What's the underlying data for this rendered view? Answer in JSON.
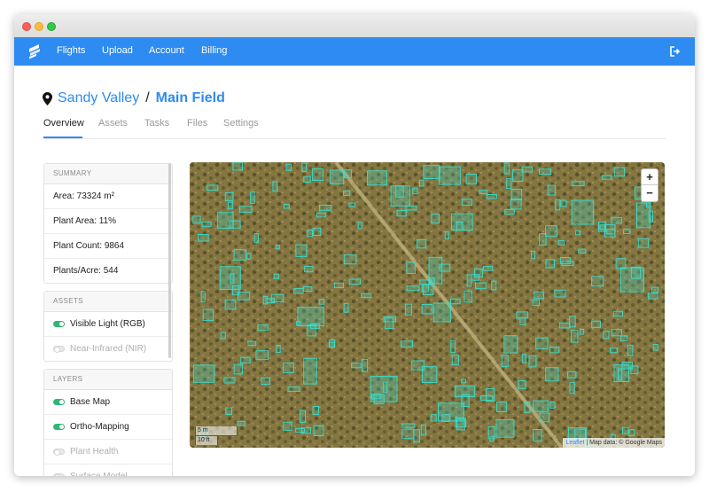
{
  "nav": {
    "items": [
      "Flights",
      "Upload",
      "Account",
      "Billing"
    ]
  },
  "breadcrumb": {
    "parent": "Sandy Valley",
    "separator": "/",
    "current": "Main Field"
  },
  "tabs": [
    "Overview",
    "Assets",
    "Tasks",
    "Files",
    "Settings"
  ],
  "active_tab": "Overview",
  "summary": {
    "header": "SUMMARY",
    "area": "Area: 73324 m²",
    "plant_area": "Plant Area: 11%",
    "plant_count": "Plant Count: 9864",
    "plants_per_acre": "Plants/Acre: 544"
  },
  "assets": {
    "header": "ASSETS",
    "items": [
      {
        "label": "Visible Light (RGB)",
        "on": true
      },
      {
        "label": "Near-Infrared (NIR)",
        "on": false
      }
    ]
  },
  "layers": {
    "header": "LAYERS",
    "items": [
      {
        "label": "Base Map",
        "on": true
      },
      {
        "label": "Ortho-Mapping",
        "on": true
      },
      {
        "label": "Plant Health",
        "on": false
      },
      {
        "label": "Surface Model",
        "on": false
      }
    ]
  },
  "map": {
    "zoom_in": "+",
    "zoom_out": "−",
    "scale_m": "5 m",
    "scale_ft": "10 ft",
    "attribution_link": "Leaflet",
    "attribution_text": " | Map data: © Google Maps"
  },
  "colors": {
    "primary": "#2d8bf2",
    "toggle_on": "#2eb872",
    "detection_box": "#34e0d0"
  }
}
